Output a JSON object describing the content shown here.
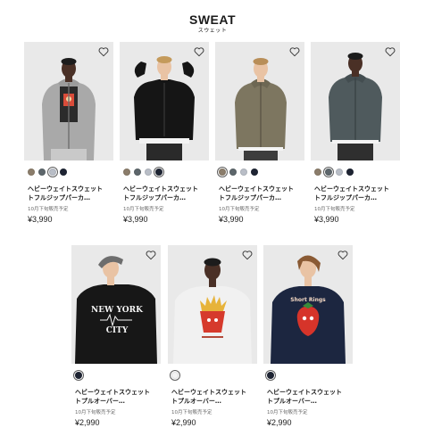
{
  "header": {
    "title": "SWEAT",
    "subtitle": "スウェット"
  },
  "colors": {
    "background": "#ffffff",
    "photo_bg": "#e9e9e9",
    "text": "#1b1b1b",
    "meta": "#6a6a6a"
  },
  "products": [
    {
      "name": "ヘビーウェイトスウェット\nトフルジップパーカ…",
      "release": "10月下旬販売予定",
      "price": "¥3,990",
      "garment_color": "#a9a9a9",
      "print": "face-graphic",
      "swatches": [
        {
          "color": "#8b7d6b",
          "selected": false
        },
        {
          "color": "#5d666b",
          "selected": false
        },
        {
          "color": "#b9bec7",
          "selected": true
        },
        {
          "color": "#1e2433",
          "selected": false
        }
      ],
      "icon": "heart-icon"
    },
    {
      "name": "ヘビーウェイトスウェット\nトフルジップパーカ…",
      "release": "10月下旬販売予定",
      "price": "¥3,990",
      "garment_color": "#151515",
      "print": "none",
      "swatches": [
        {
          "color": "#8b7d6b",
          "selected": false
        },
        {
          "color": "#5d666b",
          "selected": false
        },
        {
          "color": "#b9bec7",
          "selected": false
        },
        {
          "color": "#1e2433",
          "selected": true
        }
      ],
      "icon": "heart-icon"
    },
    {
      "name": "ヘビーウェイトスウェット\nトフルジップパーカ…",
      "release": "10月下旬販売予定",
      "price": "¥3,990",
      "garment_color": "#7d7660",
      "print": "none",
      "swatches": [
        {
          "color": "#8b7d6b",
          "selected": true
        },
        {
          "color": "#5d666b",
          "selected": false
        },
        {
          "color": "#b9bec7",
          "selected": false
        },
        {
          "color": "#1e2433",
          "selected": false
        }
      ],
      "icon": "heart-icon"
    },
    {
      "name": "ヘビーウェイトスウェット\nトフルジップパーカ…",
      "release": "10月下旬販売予定",
      "price": "¥3,990",
      "garment_color": "#4f5a5d",
      "print": "none",
      "swatches": [
        {
          "color": "#8b7d6b",
          "selected": false
        },
        {
          "color": "#5d666b",
          "selected": true
        },
        {
          "color": "#b9bec7",
          "selected": false
        },
        {
          "color": "#1e2433",
          "selected": false
        }
      ],
      "icon": "heart-icon"
    },
    {
      "name": "ヘビーウェイトスウェット\nトプルオーバー…",
      "release": "10月下旬販売予定",
      "price": "¥2,990",
      "garment_color": "#171717",
      "print": "new-york-city",
      "print_text": [
        "NEW YORK",
        "CITY"
      ],
      "swatches": [
        {
          "color": "#1e2433",
          "selected": true
        }
      ],
      "icon": "heart-icon"
    },
    {
      "name": "ヘビーウェイトスウェット\nトプルオーバー…",
      "release": "10月下旬販売予定",
      "price": "¥2,990",
      "garment_color": "#f1f1f1",
      "print": "fries-graphic",
      "swatches": [
        {
          "color": "#f4f4f4",
          "selected": true
        }
      ],
      "icon": "heart-icon"
    },
    {
      "name": "ヘビーウェイトスウェット\nトプルオーバー…",
      "release": "10月下旬販売予定",
      "price": "¥2,990",
      "garment_color": "#1c2640",
      "print": "strawberry-graphic",
      "print_text": [
        "Short Rings"
      ],
      "swatches": [
        {
          "color": "#1e2433",
          "selected": true
        }
      ],
      "icon": "heart-icon"
    }
  ]
}
